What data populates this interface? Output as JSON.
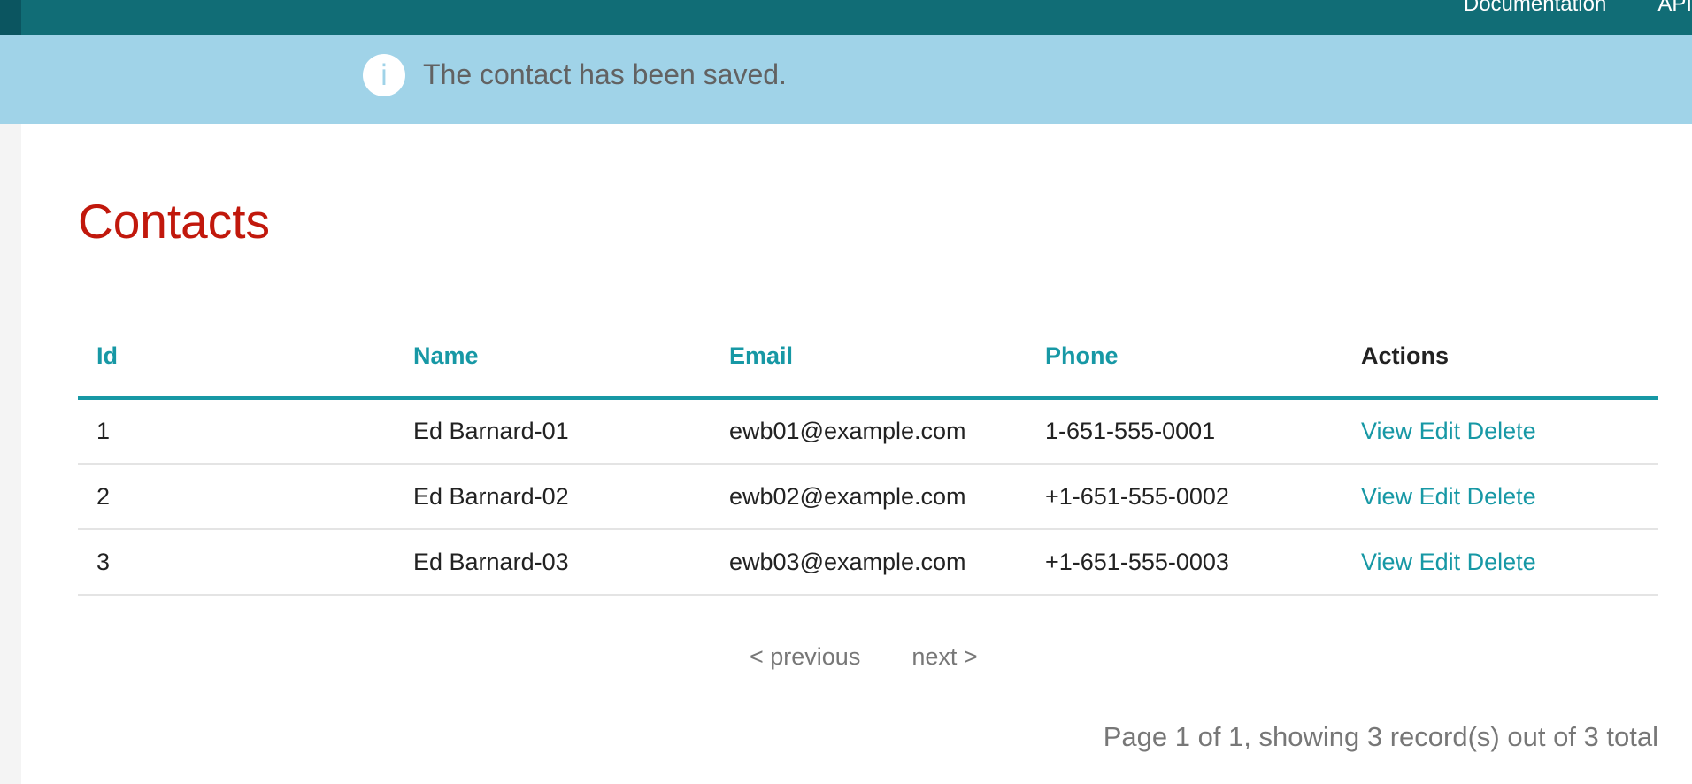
{
  "topnav": {
    "items": [
      "Documentation",
      "API"
    ]
  },
  "flash": {
    "icon": "info-icon",
    "message": "The contact has been saved."
  },
  "page": {
    "title": "Contacts"
  },
  "table": {
    "headers": {
      "id": "Id",
      "name": "Name",
      "email": "Email",
      "phone": "Phone",
      "actions": "Actions"
    },
    "rows": [
      {
        "id": "1",
        "name": "Ed Barnard-01",
        "email": "ewb01@example.com",
        "phone": "1-651-555-0001",
        "view": "View",
        "edit": "Edit",
        "delete": "Delete"
      },
      {
        "id": "2",
        "name": "Ed Barnard-02",
        "email": "ewb02@example.com",
        "phone": "+1-651-555-0002",
        "view": "View",
        "edit": "Edit",
        "delete": "Delete"
      },
      {
        "id": "3",
        "name": "Ed Barnard-03",
        "email": "ewb03@example.com",
        "phone": "+1-651-555-0003",
        "view": "View",
        "edit": "Edit",
        "delete": "Delete"
      }
    ]
  },
  "pagination": {
    "previous": "< previous",
    "next": "next >",
    "summary": "Page 1 of 1, showing 3 record(s) out of 3 total"
  },
  "colors": {
    "topbar": "#116d76",
    "flash_bg": "#a0d3e8",
    "title": "#c1180c",
    "accent": "#1798a5"
  }
}
